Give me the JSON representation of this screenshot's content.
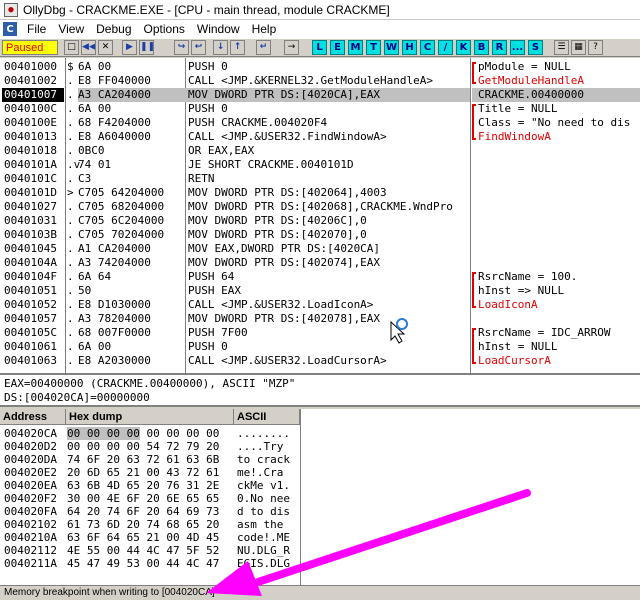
{
  "window": {
    "title": "OllyDbg - CRACKME.EXE - [CPU - main thread, module CRACKME]",
    "menu_c": "C"
  },
  "menu": [
    "File",
    "View",
    "Debug",
    "Options",
    "Window",
    "Help"
  ],
  "toolbar": {
    "status": "Paused",
    "letters": [
      "L",
      "E",
      "M",
      "T",
      "W",
      "H",
      "C",
      "/",
      "K",
      "B",
      "R",
      "...",
      "S"
    ]
  },
  "disasm": {
    "rows": [
      {
        "addr": "00401000",
        "mark": "$",
        "hex": "6A 00",
        "dis": "PUSH 0",
        "cmt": "pModule = NULL",
        "cmt_red": false
      },
      {
        "addr": "00401002",
        "mark": ".",
        "hex": "E8 FF040000",
        "dis": "CALL <JMP.&KERNEL32.GetModuleHandleA>",
        "cmt": "GetModuleHandleA",
        "cmt_red": true
      },
      {
        "addr": "00401007",
        "mark": ".",
        "hex": "A3 CA204000",
        "dis": "MOV DWORD PTR DS:[4020CA],EAX",
        "cmt": "CRACKME.00400000",
        "cmt_red": false,
        "selected": true
      },
      {
        "addr": "0040100C",
        "mark": ".",
        "hex": "6A 00",
        "dis": "PUSH 0",
        "cmt": "Title = NULL",
        "cmt_red": false
      },
      {
        "addr": "0040100E",
        "mark": ".",
        "hex": "68 F4204000",
        "dis": "PUSH CRACKME.004020F4",
        "cmt": "Class = \"No need to dis",
        "cmt_red": false
      },
      {
        "addr": "00401013",
        "mark": ".",
        "hex": "E8 A6040000",
        "dis": "CALL <JMP.&USER32.FindWindowA>",
        "cmt": "FindWindowA",
        "cmt_red": true
      },
      {
        "addr": "00401018",
        "mark": ".",
        "hex": "0BC0",
        "dis": "OR EAX,EAX",
        "cmt": "",
        "cmt_red": false
      },
      {
        "addr": "0040101A",
        "mark": ".v",
        "hex": "74 01",
        "dis": "JE SHORT CRACKME.0040101D",
        "cmt": "",
        "cmt_red": false
      },
      {
        "addr": "0040101C",
        "mark": ".",
        "hex": "C3",
        "dis": "RETN",
        "cmt": "",
        "cmt_red": false
      },
      {
        "addr": "0040101D",
        "mark": ">",
        "hex": "C705 64204000",
        "dis": "MOV DWORD PTR DS:[402064],4003",
        "cmt": "",
        "cmt_red": false
      },
      {
        "addr": "00401027",
        "mark": ".",
        "hex": "C705 68204000",
        "dis": "MOV DWORD PTR DS:[402068],CRACKME.WndPro",
        "cmt": "",
        "cmt_red": false
      },
      {
        "addr": "00401031",
        "mark": ".",
        "hex": "C705 6C204000",
        "dis": "MOV DWORD PTR DS:[40206C],0",
        "cmt": "",
        "cmt_red": false
      },
      {
        "addr": "0040103B",
        "mark": ".",
        "hex": "C705 70204000",
        "dis": "MOV DWORD PTR DS:[402070],0",
        "cmt": "",
        "cmt_red": false
      },
      {
        "addr": "00401045",
        "mark": ".",
        "hex": "A1 CA204000",
        "dis": "MOV EAX,DWORD PTR DS:[4020CA]",
        "cmt": "",
        "cmt_red": false
      },
      {
        "addr": "0040104A",
        "mark": ".",
        "hex": "A3 74204000",
        "dis": "MOV DWORD PTR DS:[402074],EAX",
        "cmt": "",
        "cmt_red": false
      },
      {
        "addr": "0040104F",
        "mark": ".",
        "hex": "6A 64",
        "dis": "PUSH 64",
        "cmt": "RsrcName = 100.",
        "cmt_red": false
      },
      {
        "addr": "00401051",
        "mark": ".",
        "hex": "50",
        "dis": "PUSH EAX",
        "cmt": "hInst => NULL",
        "cmt_red": false
      },
      {
        "addr": "00401052",
        "mark": ".",
        "hex": "E8 D1030000",
        "dis": "CALL <JMP.&USER32.LoadIconA>",
        "cmt": "LoadIconA",
        "cmt_red": true
      },
      {
        "addr": "00401057",
        "mark": ".",
        "hex": "A3 78204000",
        "dis": "MOV DWORD PTR DS:[402078],EAX",
        "cmt": "",
        "cmt_red": false
      },
      {
        "addr": "0040105C",
        "mark": ".",
        "hex": "68 007F0000",
        "dis": "PUSH 7F00",
        "cmt": "RsrcName = IDC_ARROW",
        "cmt_red": false
      },
      {
        "addr": "00401061",
        "mark": ".",
        "hex": "6A 00",
        "dis": "PUSH 0",
        "cmt": "hInst = NULL",
        "cmt_red": false
      },
      {
        "addr": "00401063",
        "mark": ".",
        "hex": "E8 A2030000",
        "dis": "CALL <JMP.&USER32.LoadCursorA>",
        "cmt": "LoadCursorA",
        "cmt_red": true
      }
    ]
  },
  "info": {
    "line1": "EAX=00400000 (CRACKME.00400000), ASCII \"MZP\"",
    "line2": "DS:[004020CA]=00000000"
  },
  "dump": {
    "headers": {
      "address": "Address",
      "hex": "Hex dump",
      "ascii": "ASCII"
    },
    "rows": [
      {
        "addr": "004020CA",
        "hex": "00 00 00 00 00 00 00 00",
        "ascii": "........",
        "hl": 4
      },
      {
        "addr": "004020D2",
        "hex": "00 00 00 00 54 72 79 20",
        "ascii": "....Try "
      },
      {
        "addr": "004020DA",
        "hex": "74 6F 20 63 72 61 63 6B",
        "ascii": "to crack"
      },
      {
        "addr": "004020E2",
        "hex": "20 6D 65 21 00 43 72 61",
        "ascii": " me!.Cra"
      },
      {
        "addr": "004020EA",
        "hex": "63 6B 4D 65 20 76 31 2E",
        "ascii": "ckMe v1."
      },
      {
        "addr": "004020F2",
        "hex": "30 00 4E 6F 20 6E 65 65",
        "ascii": "0.No nee"
      },
      {
        "addr": "004020FA",
        "hex": "64 20 74 6F 20 64 69 73",
        "ascii": "d to dis"
      },
      {
        "addr": "00402102",
        "hex": "61 73 6D 20 74 68 65 20",
        "ascii": "asm the "
      },
      {
        "addr": "0040210A",
        "hex": "63 6F 64 65 21 00 4D 45",
        "ascii": "code!.ME"
      },
      {
        "addr": "00402112",
        "hex": "4E 55 00 44 4C 47 5F 52",
        "ascii": "NU.DLG_R"
      },
      {
        "addr": "0040211A",
        "hex": "45 47 49 53 00 44 4C 47",
        "ascii": "EGIS.DLG"
      }
    ]
  },
  "status": {
    "text": "Memory breakpoint when writing to [004020CA]"
  },
  "colors": {
    "annotation_arrow": "#ff00ff",
    "api_name_red": "#e00000",
    "paused_bg": "#ffff00"
  }
}
